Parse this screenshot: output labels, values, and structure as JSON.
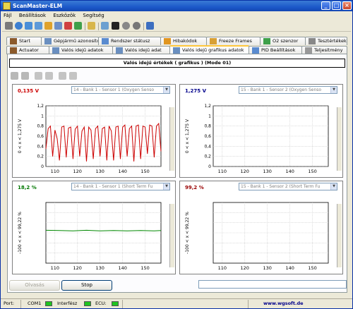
{
  "window": {
    "title": "ScanMaster-ELM"
  },
  "menu": [
    "Fájl",
    "Beállítások",
    "Eszközök",
    "Segítség"
  ],
  "tabs_row1": [
    "Start",
    "Gépjármű azonosító",
    "Rendszer státusz",
    "Hibakódok",
    "Freeze Frames",
    "O2 szenzor",
    "Tesztértékek"
  ],
  "tabs_row2": [
    "Actuator",
    "Valós idejű adatok",
    "Valós idejű adat",
    "Valós idejű grafikus adatok",
    "PID Beállítások",
    "Teljesítmény"
  ],
  "header": {
    "title": "Valós idejű értékek ( grafikus ) (Mode 01)"
  },
  "charts": [
    {
      "value": "0,135 V",
      "value_color": "#cc0000",
      "sensor": "14 - Bank 1 - Sensor 1 (Oxygen Senso",
      "ylabel": "0 < x < 1,275 V"
    },
    {
      "value": "1,275 V",
      "value_color": "#00008b",
      "sensor": "15 - Bank 1 - Sensor 2 (Oxygen Senso",
      "ylabel": "0 < x < 1,275 V"
    },
    {
      "value": "18,2 %",
      "value_color": "#007700",
      "sensor": "14 - Bank 1 - Sensor 1 (Short Term Fu",
      "ylabel": "-100 < x < 99,22 %"
    },
    {
      "value": "99,2 %",
      "value_color": "#990000",
      "sensor": "15 - Bank 1 - Sensor 2 (Short Term Fu",
      "ylabel": "-100 < x < 99,22 %"
    }
  ],
  "chart_data": [
    {
      "type": "line",
      "ylim": [
        0,
        1.2
      ],
      "xlim": [
        106,
        157
      ],
      "x_ticks": [
        110,
        120,
        130,
        140,
        150
      ],
      "y_ticks": [
        "0",
        "0,2",
        "0,4",
        "0,6",
        "0,8",
        "1",
        "1,2"
      ],
      "series": [
        {
          "color": "#cc0000",
          "x": [
            106,
            107,
            108,
            109,
            110,
            111,
            112,
            113,
            114,
            115,
            116,
            117,
            118,
            119,
            120,
            121,
            122,
            123,
            124,
            125,
            126,
            127,
            128,
            129,
            130,
            131,
            132,
            133,
            134,
            135,
            136,
            137,
            138,
            139,
            140,
            141,
            142,
            143,
            144,
            145,
            146,
            147,
            148,
            149,
            150,
            151,
            152,
            153,
            154,
            155,
            156,
            157
          ],
          "values": [
            0.35,
            0.75,
            0.8,
            0.2,
            0.72,
            0.55,
            0.12,
            0.78,
            0.8,
            0.18,
            0.76,
            0.78,
            0.15,
            0.74,
            0.8,
            0.2,
            0.7,
            0.78,
            0.1,
            0.78,
            0.72,
            0.15,
            0.75,
            0.8,
            0.2,
            0.75,
            0.78,
            0.12,
            0.8,
            0.7,
            0.12,
            0.78,
            0.8,
            0.15,
            0.78,
            0.82,
            0.2,
            0.75,
            0.8,
            0.1,
            0.8,
            0.82,
            0.15,
            0.8,
            0.78,
            0.25,
            0.82,
            0.8,
            0.18,
            0.8,
            0.85,
            0.3
          ]
        }
      ]
    },
    {
      "type": "line",
      "ylim": [
        0,
        1.2
      ],
      "x_ticks": [
        110,
        120,
        130,
        140,
        150
      ],
      "y_ticks": [
        "0",
        "0,2",
        "0,4",
        "0,6",
        "0,8",
        "1",
        "1,2"
      ],
      "series": []
    },
    {
      "type": "line",
      "ylim": [
        -100,
        99.22
      ],
      "xlim": [
        106,
        157
      ],
      "x_ticks": [
        110,
        120,
        130,
        140,
        150
      ],
      "y_ticks": [],
      "series": [
        {
          "color": "#008800",
          "x": [
            106,
            112,
            118,
            124,
            130,
            136,
            142,
            148,
            154,
            157
          ],
          "values": [
            8,
            7,
            6,
            8,
            6,
            7,
            6,
            7,
            6,
            7
          ]
        }
      ]
    },
    {
      "type": "line",
      "ylim": [
        -100,
        99.22
      ],
      "x_ticks": [
        110,
        120,
        130,
        140,
        150
      ],
      "y_ticks": [],
      "series": []
    }
  ],
  "buttons": {
    "read": "Olvasás",
    "stop": "Stop"
  },
  "status": {
    "port_label": "Port:",
    "com": "COM1",
    "interface": "Interfész",
    "ecu": "ECU:",
    "website": "www.wgsoft.de"
  }
}
